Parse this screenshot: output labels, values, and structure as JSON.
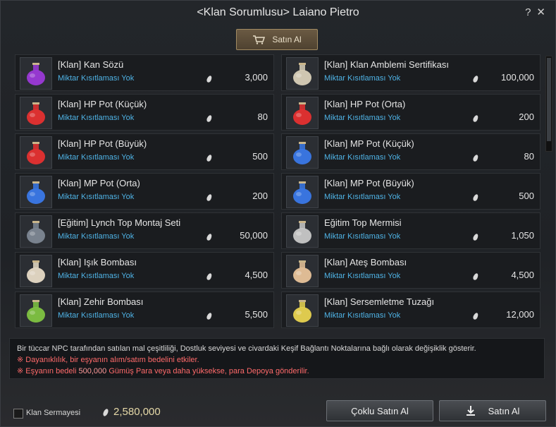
{
  "window": {
    "title": "<Klan Sorumlusu> Laiano Pietro",
    "help_icon": "?",
    "close_icon": "✕"
  },
  "tabs": {
    "buy_label": "Satın Al"
  },
  "items": [
    {
      "name": "[Klan] Kan Sözü",
      "limit": "Miktar Kısıtlaması Yok",
      "price": "3,000",
      "icon": "purple-potion-icon",
      "color": "#9b39d8"
    },
    {
      "name": "[Klan] Klan Amblemi Sertifikası",
      "limit": "Miktar Kısıtlaması Yok",
      "price": "100,000",
      "icon": "certificate-icon",
      "color": "#d8cfb8"
    },
    {
      "name": "[Klan] HP Pot (Küçük)",
      "limit": "Miktar Kısıtlaması Yok",
      "price": "80",
      "icon": "red-potion-small-icon",
      "color": "#e53030"
    },
    {
      "name": "[Klan] HP Pot (Orta)",
      "limit": "Miktar Kısıtlaması Yok",
      "price": "200",
      "icon": "red-potion-medium-icon",
      "color": "#e53030"
    },
    {
      "name": "[Klan] HP Pot (Büyük)",
      "limit": "Miktar Kısıtlaması Yok",
      "price": "500",
      "icon": "red-potion-large-icon",
      "color": "#e53030"
    },
    {
      "name": "[Klan] MP Pot (Küçük)",
      "limit": "Miktar Kısıtlaması Yok",
      "price": "80",
      "icon": "blue-potion-small-icon",
      "color": "#3a78e8"
    },
    {
      "name": "[Klan] MP Pot (Orta)",
      "limit": "Miktar Kısıtlaması Yok",
      "price": "200",
      "icon": "blue-potion-medium-icon",
      "color": "#3a78e8"
    },
    {
      "name": "[Klan] MP Pot (Büyük)",
      "limit": "Miktar Kısıtlaması Yok",
      "price": "500",
      "icon": "blue-potion-large-icon",
      "color": "#3a78e8"
    },
    {
      "name": "[Eğitim] Lynch Top Montaj Seti",
      "limit": "Miktar Kısıtlaması Yok",
      "price": "50,000",
      "icon": "cannon-kit-icon",
      "color": "#7d8794"
    },
    {
      "name": "Eğitim Top Mermisi",
      "limit": "Miktar Kısıtlaması Yok",
      "price": "1,050",
      "icon": "cannonballs-icon",
      "color": "#c8c8c8"
    },
    {
      "name": "[Klan] Işık Bombası",
      "limit": "Miktar Kısıtlaması Yok",
      "price": "4,500",
      "icon": "light-bomb-icon",
      "color": "#e6dac6"
    },
    {
      "name": "[Klan] Ateş Bombası",
      "limit": "Miktar Kısıtlaması Yok",
      "price": "4,500",
      "icon": "fire-bomb-icon",
      "color": "#e8c39a"
    },
    {
      "name": "[Klan] Zehir Bombası",
      "limit": "Miktar Kısıtlaması Yok",
      "price": "5,500",
      "icon": "poison-bomb-icon",
      "color": "#7fc342"
    },
    {
      "name": "[Klan] Sersemletme Tuzağı",
      "limit": "Miktar Kısıtlaması Yok",
      "price": "12,000",
      "icon": "stun-trap-icon",
      "color": "#e8d350"
    }
  ],
  "notes": {
    "line1": "Bir tüccar NPC tarafından satılan mal çeşitliliği, Dostluk seviyesi ve civardaki Keşif Bağlantı Noktalarına bağlı olarak değişiklik gösterir.",
    "line2": "※ Dayanıklılık, bir eşyanın alım/satım bedelini etkiler.",
    "line3_prefix": "※ Eşyanın bedeli ",
    "line3_amount": "500,000",
    "line3_suffix": " Gümüş Para veya daha yüksekse, para Depoya gönderilir."
  },
  "bottom": {
    "checkbox_label": "Klan Sermayesi",
    "funds": "2,580,000",
    "multi_buy_label": "Çoklu Satın Al",
    "buy_label": "Satın Al"
  }
}
